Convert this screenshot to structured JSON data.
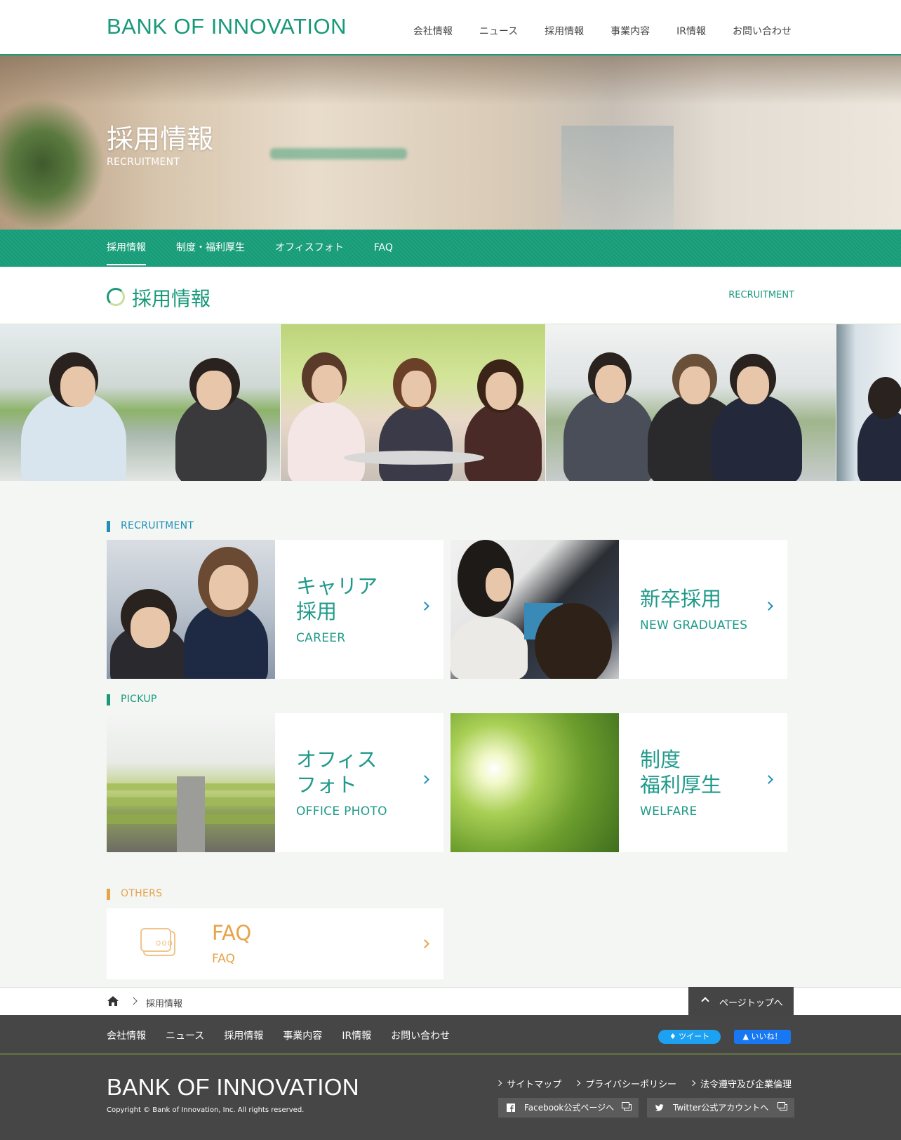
{
  "header": {
    "logo": "BANK OF INNOVATION",
    "nav": [
      "会社情報",
      "ニュース",
      "採用情報",
      "事業内容",
      "IR情報",
      "お問い合わせ"
    ]
  },
  "hero": {
    "title": "採用情報",
    "subtitle": "RECRUITMENT"
  },
  "subnav": {
    "items": [
      "採用情報",
      "制度・福利厚生",
      "オフィスフォト",
      "FAQ"
    ],
    "active_index": 0
  },
  "section": {
    "title": "採用情報",
    "en": "RECRUITMENT"
  },
  "recruitment": {
    "label": "RECRUITMENT",
    "cards": [
      {
        "jp_line1": "キャリア",
        "jp_line2": "採用",
        "en": "CAREER"
      },
      {
        "jp_line1": "新卒採用",
        "jp_line2": "",
        "en": "NEW GRADUATES"
      }
    ]
  },
  "pickup": {
    "label": "PICKUP",
    "cards": [
      {
        "jp_line1": "オフィス",
        "jp_line2": "フォト",
        "en": "OFFICE PHOTO"
      },
      {
        "jp_line1": "制度",
        "jp_line2": "福利厚生",
        "en": "WELFARE"
      }
    ]
  },
  "others": {
    "label": "OTHERS",
    "faq": {
      "jp": "FAQ",
      "en": "FAQ",
      "icon_dots": "ooo"
    }
  },
  "breadcrumb": {
    "current": "採用情報",
    "page_top": "ページトップへ"
  },
  "footer": {
    "nav": [
      "会社情報",
      "ニュース",
      "採用情報",
      "事業内容",
      "IR情報",
      "お問い合わせ"
    ],
    "tweet": "ツイート",
    "like": "いいね！",
    "logo": "BANK OF INNOVATION",
    "copyright": "Copyright © Bank of Innovation, Inc. All rights reserved.",
    "links": [
      "サイトマップ",
      "プライバシーポリシー",
      "法令遵守及び企業倫理"
    ],
    "facebook": "Facebook公式ページへ",
    "twitter": "Twitter公式アカウントへ"
  },
  "colors": {
    "brand_green": "#17997a",
    "accent_blue": "#1e8fb8",
    "accent_orange": "#e6a34a",
    "footer_bg": "#464646"
  }
}
